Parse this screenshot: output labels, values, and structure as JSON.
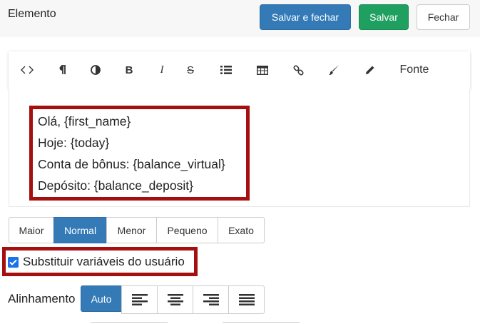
{
  "header": {
    "title": "Elemento",
    "save_close_label": "Salvar e fechar",
    "save_label": "Salvar",
    "close_label": "Fechar"
  },
  "toolbar": {
    "items": [
      "code-icon",
      "paragraph-icon",
      "contrast-icon",
      "bold-icon",
      "italic-icon",
      "strikethrough-icon",
      "list-icon",
      "table-icon",
      "link-icon",
      "brush-icon",
      "pencil-icon"
    ],
    "font_label": "Fonte"
  },
  "editor": {
    "lines": [
      "Olá, {first_name}",
      "Hoje: {today}",
      "Conta de bônus: {balance_virtual}",
      "Depósito: {balance_deposit}"
    ]
  },
  "size_group": {
    "options": [
      "Maior",
      "Normal",
      "Menor",
      "Pequeno",
      "Exato"
    ],
    "selected": "Normal"
  },
  "replace_vars": {
    "label": "Substituir variáveis do usuário",
    "checked": true
  },
  "alignment": {
    "label": "Alinhamento",
    "auto_label": "Auto",
    "options": [
      "align-left-icon",
      "align-center-icon",
      "align-right-icon",
      "align-justify-icon"
    ]
  },
  "colors": {
    "primary": "#337ab7",
    "success": "#20a060",
    "highlight": "#a50f0f"
  }
}
